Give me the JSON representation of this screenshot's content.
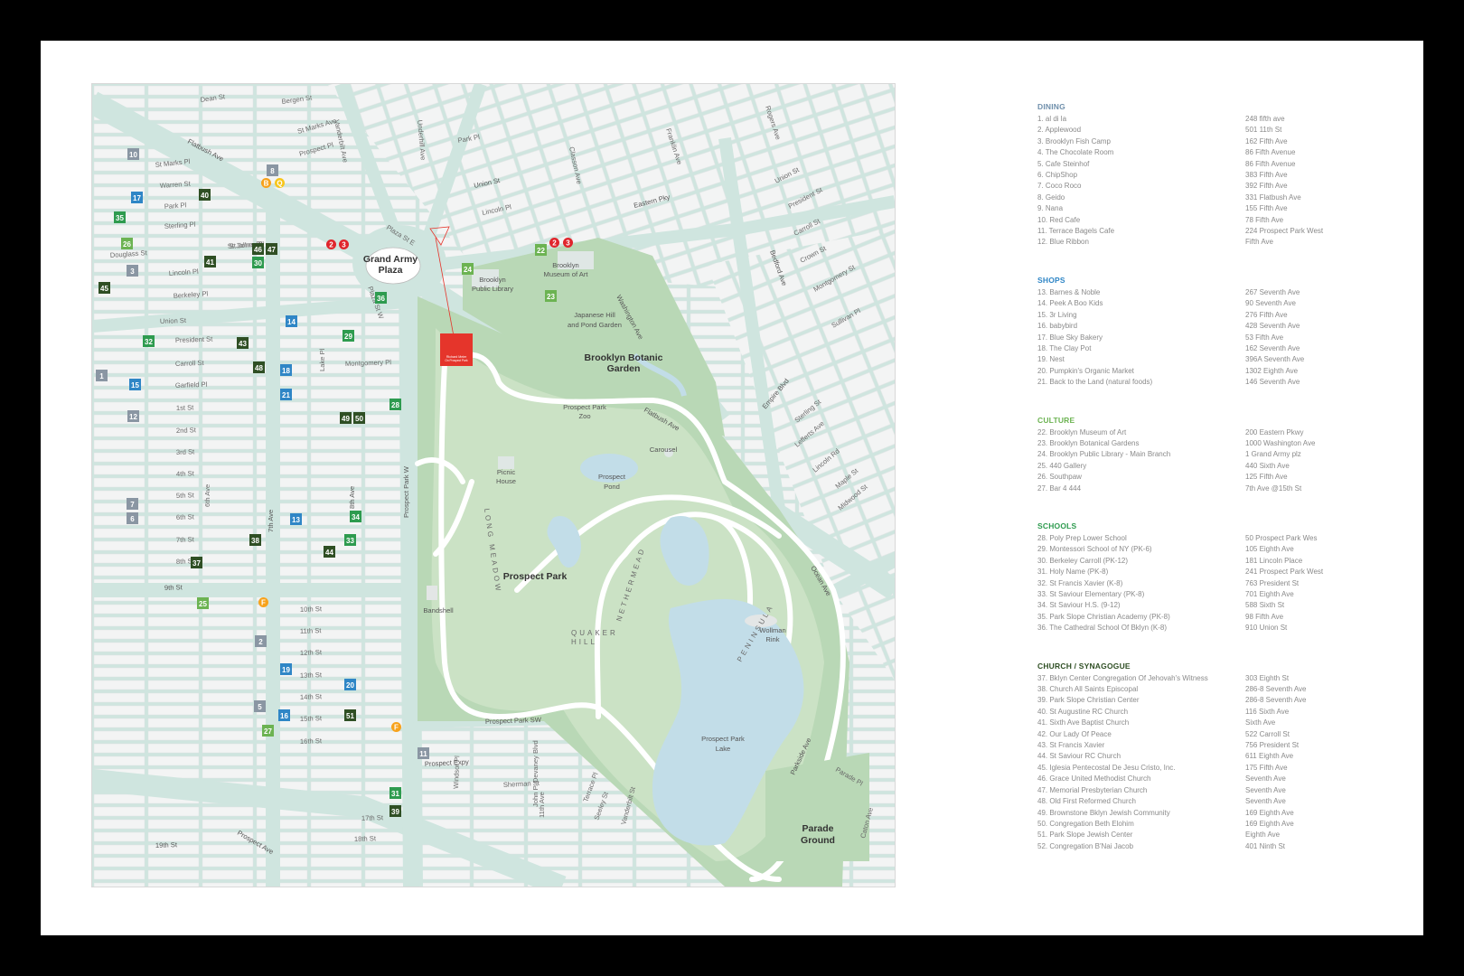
{
  "map": {
    "streets": [
      {
        "label": "Dean St"
      },
      {
        "label": "Bergen St"
      },
      {
        "label": "Vanderbilt Ave"
      },
      {
        "label": "Underhill Ave"
      },
      {
        "label": "Franklin Ave"
      },
      {
        "label": "Rogers Ave"
      },
      {
        "label": "Flatbush Ave"
      },
      {
        "label": "St Marks Ave"
      },
      {
        "label": "St Marks Pl"
      },
      {
        "label": "Prospect Pl"
      },
      {
        "label": "Park Pl"
      },
      {
        "label": "Classon Ave"
      },
      {
        "label": "Warren St"
      },
      {
        "label": "Park Pl"
      },
      {
        "label": "St Johns Pl"
      },
      {
        "label": "Eastern Pky"
      },
      {
        "label": "Union St"
      },
      {
        "label": "Lincoln Pl"
      },
      {
        "label": "Plaza St E"
      },
      {
        "label": "Sterling Pl"
      },
      {
        "label": "St Johns Pl"
      },
      {
        "label": "Douglass St"
      },
      {
        "label": "Lincoln Pl"
      },
      {
        "label": "Plaza St W"
      },
      {
        "label": "Berkeley Pl"
      },
      {
        "label": "Union St"
      },
      {
        "label": "President St"
      },
      {
        "label": "Carroll St"
      },
      {
        "label": "Montgomery Pl"
      },
      {
        "label": "Garfield Pl"
      },
      {
        "label": "1st St"
      },
      {
        "label": "2nd St"
      },
      {
        "label": "3rd St"
      },
      {
        "label": "4th St"
      },
      {
        "label": "5th St"
      },
      {
        "label": "6th St"
      },
      {
        "label": "7th St"
      },
      {
        "label": "8th St"
      },
      {
        "label": "9th St"
      },
      {
        "label": "10th St"
      },
      {
        "label": "11th St"
      },
      {
        "label": "12th St"
      },
      {
        "label": "13th St"
      },
      {
        "label": "14th St"
      },
      {
        "label": "15th St"
      },
      {
        "label": "16th St"
      },
      {
        "label": "17th St"
      },
      {
        "label": "18th St"
      },
      {
        "label": "19th St"
      },
      {
        "label": "Prospect Ave"
      },
      {
        "label": "Prospect Expy"
      },
      {
        "label": "Windsor Pl"
      },
      {
        "label": "Sherman St"
      },
      {
        "label": "John P. Devaney Blvd"
      },
      {
        "label": "11th Ave"
      },
      {
        "label": "Terrace Pl"
      },
      {
        "label": "Seeley St"
      },
      {
        "label": "Vanderbilt St"
      },
      {
        "label": "Prospect Park SW"
      },
      {
        "label": "Prospect Park W"
      },
      {
        "label": "7th Ave"
      },
      {
        "label": "8th Ave"
      },
      {
        "label": "6th Ave"
      },
      {
        "label": "Lake Pl"
      },
      {
        "label": "Washington Ave"
      },
      {
        "label": "Bedford Ave"
      },
      {
        "label": "Union St"
      },
      {
        "label": "President St"
      },
      {
        "label": "Carroll St"
      },
      {
        "label": "Crown St"
      },
      {
        "label": "Montgomery St"
      },
      {
        "label": "Sullivan Pl"
      },
      {
        "label": "Empire Blvd"
      },
      {
        "label": "Sterling St"
      },
      {
        "label": "Lefferts Ave"
      },
      {
        "label": "Lincoln Rd"
      },
      {
        "label": "Maple St"
      },
      {
        "label": "Midwood St"
      },
      {
        "label": "Ocean Ave"
      },
      {
        "label": "Parkside Ave"
      },
      {
        "label": "Parade Pl"
      },
      {
        "label": "Caton Ave"
      },
      {
        "label": "Flatbush Ave"
      }
    ],
    "places": [
      {
        "label": "Grand Army"
      },
      {
        "label": "Plaza"
      },
      {
        "label": "Brooklyn"
      },
      {
        "label": "Public Library"
      },
      {
        "label": "Brooklyn"
      },
      {
        "label": "Museum of Art"
      },
      {
        "label": "Japanese Hill"
      },
      {
        "label": "and Pond Garden"
      },
      {
        "label": "Brooklyn Botanic"
      },
      {
        "label": "Garden"
      },
      {
        "label": "Prospect Park"
      },
      {
        "label": "Zoo"
      },
      {
        "label": "Carousel"
      },
      {
        "label": "Picnic"
      },
      {
        "label": "House"
      },
      {
        "label": "Prospect"
      },
      {
        "label": "Pond"
      },
      {
        "label": "Prospect Park"
      },
      {
        "label": "Bandshell"
      },
      {
        "label": "Wollman"
      },
      {
        "label": "Rink"
      },
      {
        "label": "Prospect Park"
      },
      {
        "label": "Lake"
      },
      {
        "label": "Parade"
      },
      {
        "label": "Ground"
      },
      {
        "label": "LONG MEADOW"
      },
      {
        "label": "NETHERMEAD"
      },
      {
        "label": "QUAKER"
      },
      {
        "label": "HILL"
      },
      {
        "label": "PENINSULA"
      }
    ],
    "hotel_label": {
      "line1": "Richard Meier",
      "line2": "On Prospect Park"
    },
    "markers": [
      {
        "n": "10",
        "cat": "dining"
      },
      {
        "n": "8",
        "cat": "dining"
      },
      {
        "n": "B",
        "cat": "subway-orange"
      },
      {
        "n": "Q",
        "cat": "subway-yellow"
      },
      {
        "n": "17",
        "cat": "shops"
      },
      {
        "n": "40",
        "cat": "church"
      },
      {
        "n": "35",
        "cat": "schools"
      },
      {
        "n": "26",
        "cat": "culture"
      },
      {
        "n": "3",
        "cat": "dining"
      },
      {
        "n": "41",
        "cat": "church"
      },
      {
        "n": "46",
        "cat": "church"
      },
      {
        "n": "47",
        "cat": "church"
      },
      {
        "n": "30",
        "cat": "schools"
      },
      {
        "n": "45",
        "cat": "church"
      },
      {
        "n": "2",
        "cat": "subway-red"
      },
      {
        "n": "3",
        "cat": "subway-red"
      },
      {
        "n": "36",
        "cat": "schools"
      },
      {
        "n": "24",
        "cat": "culture"
      },
      {
        "n": "22",
        "cat": "culture"
      },
      {
        "n": "2",
        "cat": "subway-red"
      },
      {
        "n": "3",
        "cat": "subway-red"
      },
      {
        "n": "23",
        "cat": "culture"
      },
      {
        "n": "14",
        "cat": "shops"
      },
      {
        "n": "32",
        "cat": "schools"
      },
      {
        "n": "43",
        "cat": "church"
      },
      {
        "n": "29",
        "cat": "schools"
      },
      {
        "n": "48",
        "cat": "church"
      },
      {
        "n": "18",
        "cat": "shops"
      },
      {
        "n": "1",
        "cat": "dining"
      },
      {
        "n": "15",
        "cat": "shops"
      },
      {
        "n": "21",
        "cat": "shops"
      },
      {
        "n": "28",
        "cat": "schools"
      },
      {
        "n": "12",
        "cat": "dining"
      },
      {
        "n": "49",
        "cat": "church"
      },
      {
        "n": "50",
        "cat": "church"
      },
      {
        "n": "7",
        "cat": "dining"
      },
      {
        "n": "6",
        "cat": "dining"
      },
      {
        "n": "13",
        "cat": "shops"
      },
      {
        "n": "34",
        "cat": "schools"
      },
      {
        "n": "38",
        "cat": "church"
      },
      {
        "n": "33",
        "cat": "schools"
      },
      {
        "n": "44",
        "cat": "church"
      },
      {
        "n": "37",
        "cat": "church"
      },
      {
        "n": "25",
        "cat": "culture"
      },
      {
        "n": "F",
        "cat": "subway-orange"
      },
      {
        "n": "2",
        "cat": "dining"
      },
      {
        "n": "19",
        "cat": "shops"
      },
      {
        "n": "20",
        "cat": "shops"
      },
      {
        "n": "5",
        "cat": "dining"
      },
      {
        "n": "16",
        "cat": "shops"
      },
      {
        "n": "51",
        "cat": "church"
      },
      {
        "n": "F",
        "cat": "subway-orange"
      },
      {
        "n": "27",
        "cat": "culture"
      },
      {
        "n": "11",
        "cat": "dining"
      },
      {
        "n": "31",
        "cat": "schools"
      },
      {
        "n": "39",
        "cat": "church"
      }
    ]
  },
  "legend": {
    "categories": [
      {
        "title": "DINING",
        "color": "#6f8fab",
        "items": [
          {
            "name": "1. al di la",
            "addr": "248 fifth ave"
          },
          {
            "name": "2. Applewood",
            "addr": "501 11th St"
          },
          {
            "name": "3. Brooklyn Fish Camp",
            "addr": "162 Fifth Ave"
          },
          {
            "name": "4. The Chocolate Room",
            "addr": "86 Fifth Avenue"
          },
          {
            "name": "5. Cafe Steinhof",
            "addr": "86 Fifth Avenue"
          },
          {
            "name": "6. ChipShop",
            "addr": "383 Fifth Ave"
          },
          {
            "name": "7. Coco Roco",
            "addr": "392 Fifth Ave"
          },
          {
            "name": "8. Geido",
            "addr": "331 Flatbush Ave"
          },
          {
            "name": "9. Nana",
            "addr": "155 Fifth Ave"
          },
          {
            "name": "10. Red Cafe",
            "addr": "78 Fifth Ave"
          },
          {
            "name": "11. Terrace Bagels Cafe",
            "addr": "224 Prospect Park West"
          },
          {
            "name": "12. Blue Ribbon",
            "addr": "Fifth Ave"
          }
        ]
      },
      {
        "title": "SHOPS",
        "color": "#2f86c6",
        "items": [
          {
            "name": "13. Barnes & Noble",
            "addr": "267 Seventh Ave"
          },
          {
            "name": "14. Peek A Boo Kids",
            "addr": "90 Seventh Ave"
          },
          {
            "name": "15. 3r Living",
            "addr": "276 Fifth Ave"
          },
          {
            "name": "16. babybird",
            "addr": "428 Seventh Ave"
          },
          {
            "name": "17. Blue Sky Bakery",
            "addr": "53 Fifth Ave"
          },
          {
            "name": "18. The Clay Pot",
            "addr": "162 Seventh Ave"
          },
          {
            "name": "19. Nest",
            "addr": "396A Seventh Ave"
          },
          {
            "name": "20. Pumpkin's Organic Market",
            "addr": "1302 Eighth Ave"
          },
          {
            "name": "21. Back to the Land (natural foods)",
            "addr": "146 Seventh Ave"
          }
        ]
      },
      {
        "title": "CULTURE",
        "color": "#6cb352",
        "items": [
          {
            "name": "22. Brooklyn Museum of Art",
            "addr": "200 Eastern Pkwy"
          },
          {
            "name": "23. Brooklyn Botanical Gardens",
            "addr": "1000 Washington Ave"
          },
          {
            "name": "24. Brooklyn Public Library - Main Branch",
            "addr": "1 Grand Army plz"
          },
          {
            "name": "25. 440 Gallery",
            "addr": "440 Sixth Ave"
          },
          {
            "name": "26. Southpaw",
            "addr": "125 Fifth Ave"
          },
          {
            "name": "27. Bar 4 444",
            "addr": "7th Ave @15th St"
          }
        ]
      },
      {
        "title": "SCHOOLS",
        "color": "#2e9b4f",
        "items": [
          {
            "name": "28. Poly Prep Lower School",
            "addr": "50 Prospect Park Wes"
          },
          {
            "name": "29. Montessori School of NY (PK-6)",
            "addr": "105 Eighth Ave"
          },
          {
            "name": "30. Berkeley Carroll (PK-12)",
            "addr": "181 Lincoln Place"
          },
          {
            "name": "31. Holy Name (PK-8)",
            "addr": "241 Prospect Park West"
          },
          {
            "name": "32. St Francis Xavier (K-8)",
            "addr": "763 President St"
          },
          {
            "name": "33. St Saviour Elementary (PK-8)",
            "addr": "701 Eighth Ave"
          },
          {
            "name": "34. St Saviour H.S. (9-12)",
            "addr": "588 Sixth St"
          },
          {
            "name": "35. Park Slope Christian Academy (PK-8)",
            "addr": "98 Fifth Ave"
          },
          {
            "name": "36. The Cathedral School Of Bklyn (K-8)",
            "addr": "910 Union St"
          }
        ]
      },
      {
        "title": "CHURCH / SYNAGOGUE",
        "color": "#2f4f24",
        "items": [
          {
            "name": "37. Bklyn Center Congregation Of Jehovah's Witness",
            "addr": "303 Eighth St"
          },
          {
            "name": "38. Church All Saints Episcopal",
            "addr": "286-8 Seventh Ave"
          },
          {
            "name": "39. Park Slope Christian Center",
            "addr": "286-8 Seventh Ave"
          },
          {
            "name": "40. St Augustine RC Church",
            "addr": "116 Sixth Ave"
          },
          {
            "name": "41. Sixth Ave Baptist Church",
            "addr": "Sixth Ave"
          },
          {
            "name": "42. Our Lady Of Peace",
            "addr": "522 Carroll St"
          },
          {
            "name": "43. St Francis Xavier",
            "addr": "756 President St"
          },
          {
            "name": "44. St Saviour RC Church",
            "addr": "611 Eighth Ave"
          },
          {
            "name": "45. Iglesia Pentecostal De Jesu Cristo, Inc.",
            "addr": "175 Fifth Ave"
          },
          {
            "name": "46. Grace United Methodist Church",
            "addr": "Seventh Ave"
          },
          {
            "name": "47. Memorial Presbyterian Church",
            "addr": "Seventh Ave"
          },
          {
            "name": "48. Old First Reformed Church",
            "addr": "Seventh Ave"
          },
          {
            "name": "49. Brownstone Bklyn Jewish Community",
            "addr": "169 Eighth Ave"
          },
          {
            "name": "50. Congregation Beth Elohim",
            "addr": "169 Eighth Ave"
          },
          {
            "name": "51. Park Slope Jewish Center",
            "addr": "Eighth Ave"
          },
          {
            "name": "52. Congregation B'Nai Jacob",
            "addr": "401 Ninth St"
          }
        ]
      }
    ]
  },
  "colors": {
    "dining": "#8a96a3",
    "shops": "#2f86c6",
    "culture": "#6cb352",
    "schools": "#2e9b4f",
    "church": "#2f4f24",
    "subway-red": "#e0252c",
    "subway-orange": "#f7a21b",
    "subway-yellow": "#f7c61b",
    "road": "#cfe5df",
    "block": "#f3f4f4",
    "park": "#b9d8b6",
    "park_light": "#cbe2c5",
    "water": "#c2dde8",
    "hotel": "#e5352b"
  }
}
